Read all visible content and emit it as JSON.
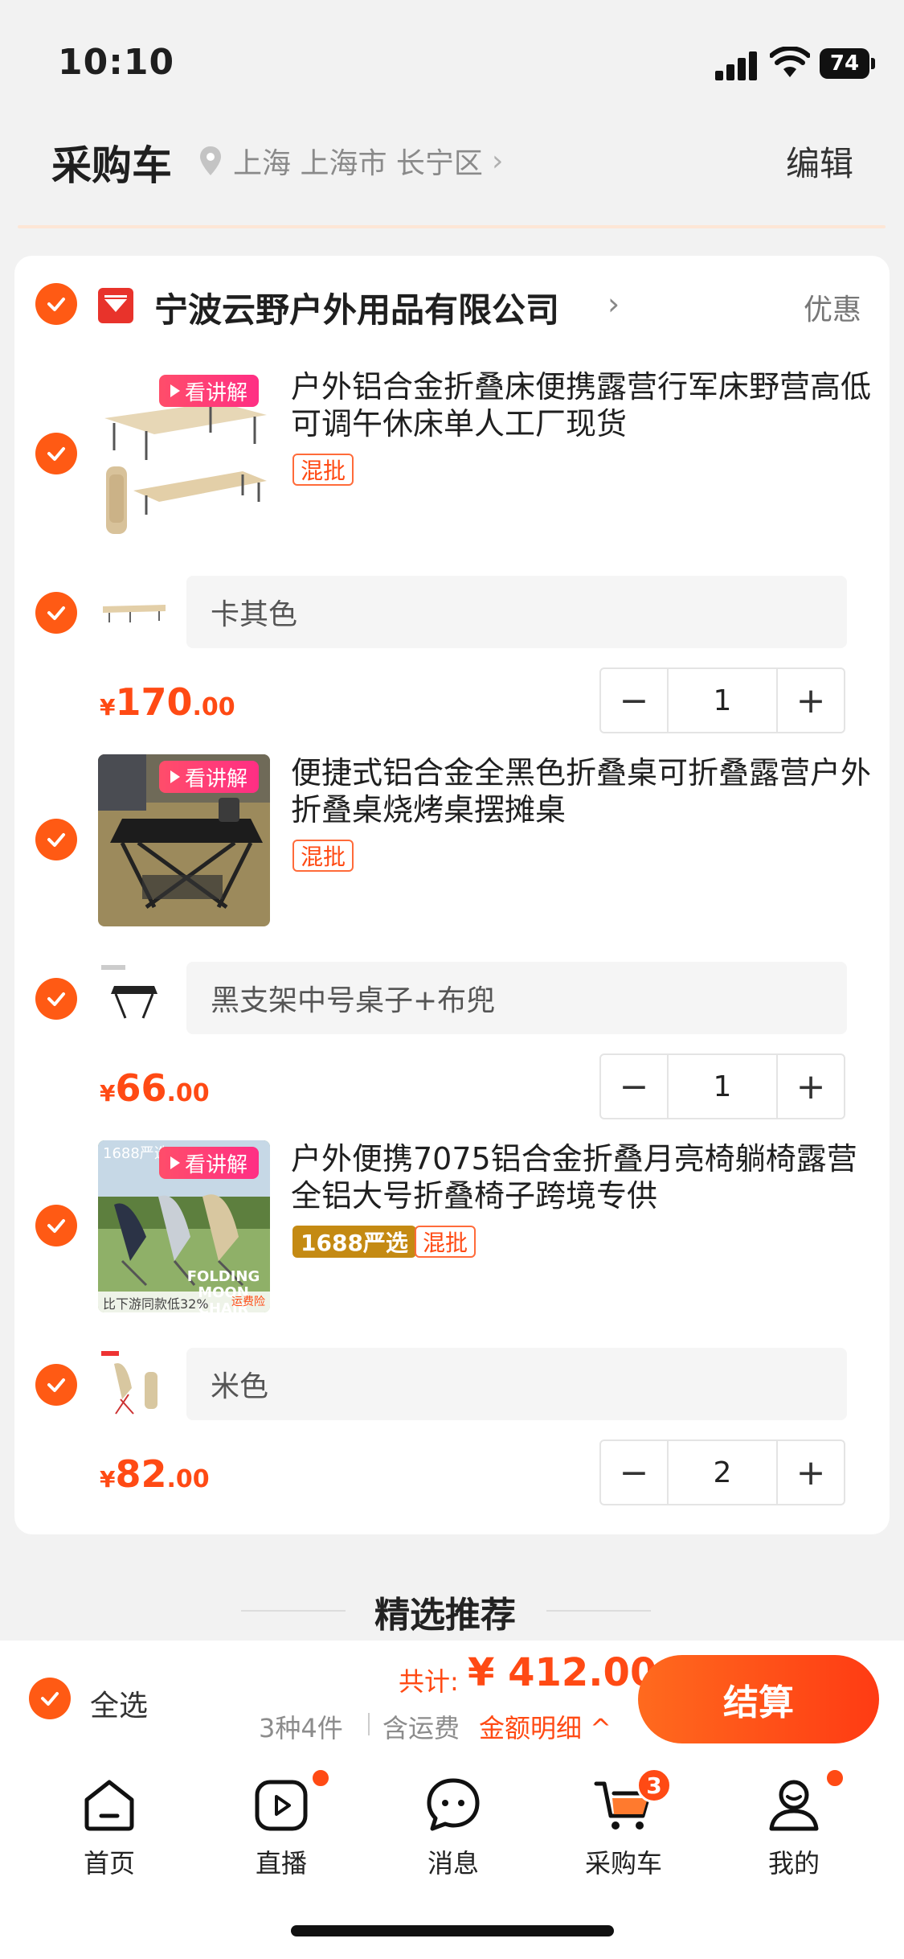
{
  "status_bar": {
    "time": "10:10",
    "battery": "74"
  },
  "header": {
    "title": "采购车",
    "location": "上海 上海市 长宁区",
    "edit_label": "编辑"
  },
  "shop": {
    "name": "宁波云野户外用品有限公司",
    "promo_label": "优惠"
  },
  "items": [
    {
      "video_label": "看讲解",
      "title": "户外铝合金折叠床便携露营行军床野营高低可调午休床单人工厂现货",
      "tags": [
        "混批"
      ],
      "sku": "卡其色",
      "price_symbol": "¥",
      "price_int": "170",
      "price_dec": ".00",
      "quantity": "1"
    },
    {
      "video_label": "看讲解",
      "title": "便捷式铝合金全黑色折叠桌可折叠露营户外折叠桌烧烤桌摆摊桌",
      "tags": [
        "混批"
      ],
      "sku": "黑支架中号桌子+布兜",
      "price_symbol": "¥",
      "price_int": "66",
      "price_dec": ".00",
      "quantity": "1"
    },
    {
      "video_label": "看讲解",
      "title": "户外便携7075铝合金折叠月亮椅躺椅露营全铝大号折叠椅子跨境专供",
      "badge": "1688严选",
      "tags": [
        "混批"
      ],
      "image_text": {
        "corner": "1688严选",
        "caption": "FOLDING MOON CHAIR",
        "footer": "比下游同款低32%",
        "footer_right": "运费险"
      },
      "sku": "米色",
      "price_symbol": "¥",
      "price_int": "82",
      "price_dec": ".00",
      "quantity": "2"
    }
  ],
  "recommend_title": "精选推荐",
  "footer": {
    "select_all": "全选",
    "total_label": "共计:",
    "total_value": "¥ 412.00",
    "summary": "3种4件",
    "shipping": "含运费",
    "detail_label": "金额明细 ^",
    "checkout_label": "结算"
  },
  "tabs": [
    {
      "label": "首页",
      "icon": "home-icon"
    },
    {
      "label": "直播",
      "icon": "live-icon"
    },
    {
      "label": "消息",
      "icon": "message-icon"
    },
    {
      "label": "采购车",
      "icon": "cart-icon",
      "badge": "3"
    },
    {
      "label": "我的",
      "icon": "profile-icon"
    }
  ],
  "colors": {
    "accent": "#ff4a14",
    "video_tag": "#ff2e84",
    "badge_gold": "#c48a13"
  }
}
